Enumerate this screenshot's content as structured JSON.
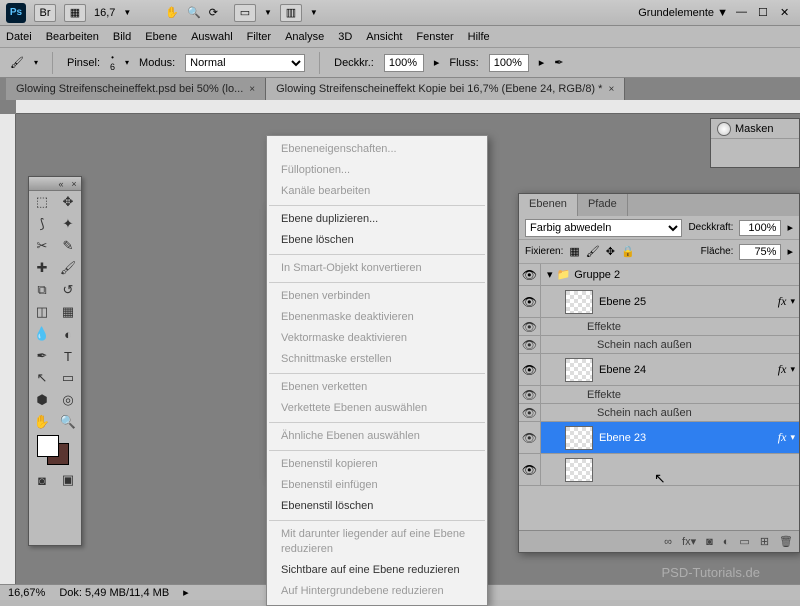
{
  "topbar": {
    "zoom_select": "16,7",
    "workspace_label": "Grundelemente"
  },
  "menu": {
    "items": [
      "Datei",
      "Bearbeiten",
      "Bild",
      "Ebene",
      "Auswahl",
      "Filter",
      "Analyse",
      "3D",
      "Ansicht",
      "Fenster",
      "Hilfe"
    ]
  },
  "opt": {
    "pinsel_label": "Pinsel:",
    "pinsel_val": "6",
    "modus_label": "Modus:",
    "modus_val": "Normal",
    "deckkr_label": "Deckkr.:",
    "deckkr_val": "100%",
    "fluss_label": "Fluss:",
    "fluss_val": "100%"
  },
  "tabs": {
    "t1": "Glowing Streifenscheineffekt.psd bei 50% (lo...",
    "t2": "Glowing Streifenscheineffekt Kopie bei 16,7% (Ebene 24, RGB/8) *"
  },
  "ctx": {
    "items": [
      {
        "label": "Ebeneneigenschaften...",
        "dis": true
      },
      {
        "label": "Fülloptionen...",
        "dis": true
      },
      {
        "label": "Kanäle bearbeiten",
        "dis": true
      },
      {
        "sep": true
      },
      {
        "label": "Ebene duplizieren...",
        "dis": false
      },
      {
        "label": "Ebene löschen",
        "dis": false
      },
      {
        "sep": true
      },
      {
        "label": "In Smart-Objekt konvertieren",
        "dis": true
      },
      {
        "sep": true
      },
      {
        "label": "Ebenen verbinden",
        "dis": true
      },
      {
        "label": "Ebenenmaske deaktivieren",
        "dis": true
      },
      {
        "label": "Vektormaske deaktivieren",
        "dis": true
      },
      {
        "label": "Schnittmaske erstellen",
        "dis": true
      },
      {
        "sep": true
      },
      {
        "label": "Ebenen verketten",
        "dis": true
      },
      {
        "label": "Verkettete Ebenen auswählen",
        "dis": true
      },
      {
        "sep": true
      },
      {
        "label": "Ähnliche Ebenen auswählen",
        "dis": true
      },
      {
        "sep": true
      },
      {
        "label": "Ebenenstil kopieren",
        "dis": true
      },
      {
        "label": "Ebenenstil einfügen",
        "dis": true
      },
      {
        "label": "Ebenenstil löschen",
        "dis": false
      },
      {
        "sep": true
      },
      {
        "label": "Mit darunter liegender auf eine Ebene reduzieren",
        "dis": true
      },
      {
        "label": "Sichtbare auf eine Ebene reduzieren",
        "dis": false
      },
      {
        "label": "Auf Hintergrundebene reduzieren",
        "dis": true
      }
    ]
  },
  "masks": {
    "title": "Masken"
  },
  "layers": {
    "tab_ebenen": "Ebenen",
    "tab_pfade": "Pfade",
    "blend": "Farbig abwedeln",
    "deckkraft_lbl": "Deckkraft:",
    "deckkraft_val": "100%",
    "fixieren_lbl": "Fixieren:",
    "flaeche_lbl": "Fläche:",
    "flaeche_val": "75%",
    "group": "Gruppe 2",
    "l25": "Ebene 25",
    "l24": "Ebene 24",
    "l23": "Ebene 23",
    "effekte": "Effekte",
    "schein": "Schein nach außen",
    "fx": "fx"
  },
  "status": {
    "zoom": "16,67%",
    "doc": "Dok: 5,49 MB/11,4 MB"
  },
  "watermark": "PSD-Tutorials.de"
}
